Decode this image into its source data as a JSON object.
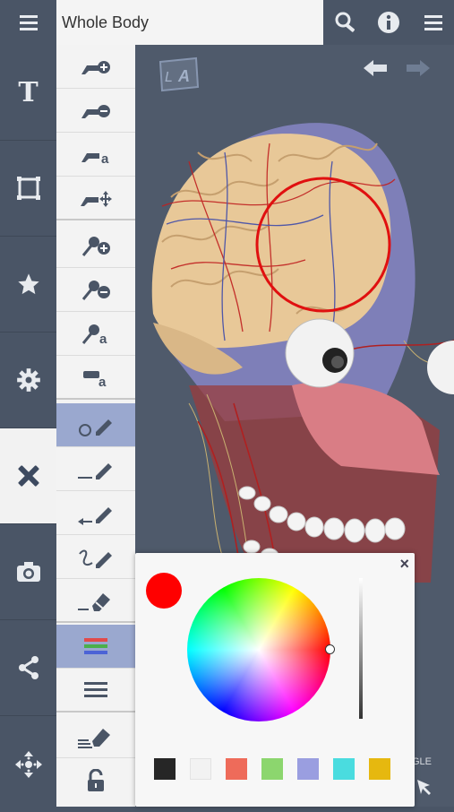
{
  "header": {
    "title": "Whole Body",
    "menu_icon": "hamburger-menu-icon",
    "search_icon": "search-icon",
    "info_icon": "info-icon",
    "overflow_icon": "overflow-menu-icon"
  },
  "sidebar": {
    "items": [
      {
        "name": "text",
        "icon": "text-T-icon",
        "label": "T"
      },
      {
        "name": "select",
        "icon": "frame-select-icon"
      },
      {
        "name": "favorites",
        "icon": "star-icon"
      },
      {
        "name": "settings",
        "icon": "gear-icon"
      },
      {
        "name": "draw",
        "icon": "pen-ruler-icon",
        "active": true
      },
      {
        "name": "camera",
        "icon": "camera-icon"
      },
      {
        "name": "share",
        "icon": "share-icon"
      },
      {
        "name": "move",
        "icon": "move-arrows-icon"
      }
    ]
  },
  "tools": [
    "add-label-icon",
    "remove-label-icon",
    "label-text-icon",
    "move-label-icon",
    "add-pin-icon",
    "remove-pin-icon",
    "pin-text-icon",
    "text-box-icon",
    "draw-circle-icon",
    "draw-line-icon",
    "draw-arrow-icon",
    "freehand-draw-icon",
    "eraser-icon",
    "color-stripes-icon",
    "line-width-icon",
    "clear-drawings-icon",
    "unlock-icon"
  ],
  "viewport": {
    "orientation_badge": "L A",
    "angle_label": "GLE"
  },
  "color_picker": {
    "close": "×",
    "selected_color": "#ff0000",
    "swatches": [
      "#262626",
      "#f2f2f2",
      "#ee6b5a",
      "#8cd66e",
      "#9a9ee0",
      "#4adcdf",
      "#e6b80f"
    ]
  }
}
